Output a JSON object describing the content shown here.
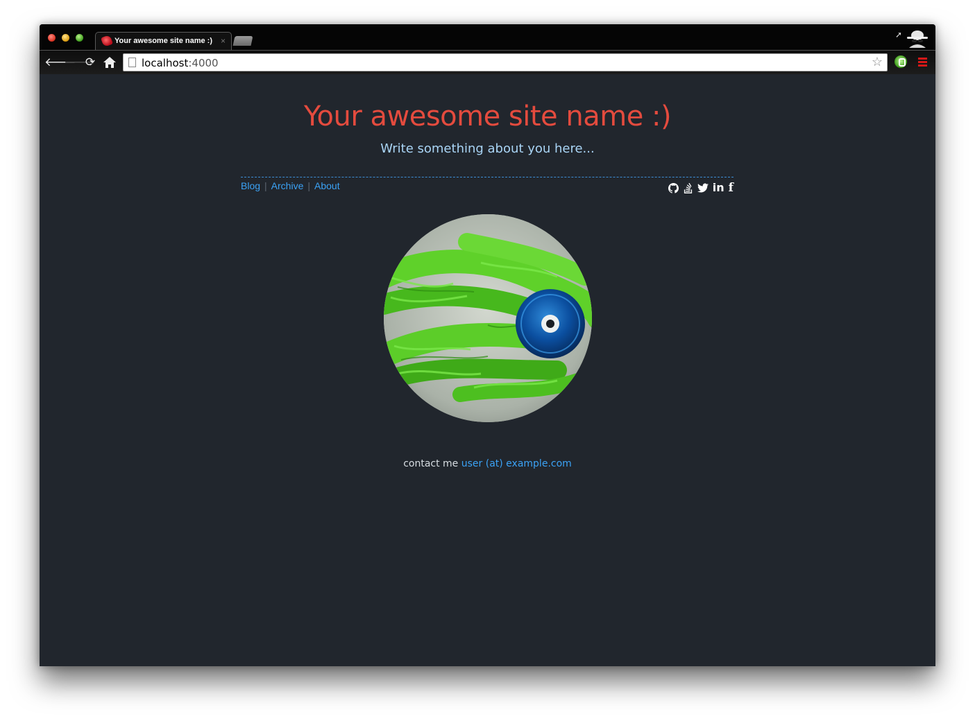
{
  "browser": {
    "tab_title": "Your awesome site name :)",
    "tab_close": "×",
    "url_host": "localhost",
    "url_port": ":4000"
  },
  "site": {
    "title": "Your awesome site name :)",
    "description": "Write something about you here..."
  },
  "nav": {
    "items": [
      {
        "label": "Blog"
      },
      {
        "label": "Archive"
      },
      {
        "label": "About"
      }
    ],
    "separator": "|"
  },
  "social": {
    "icons": [
      "github-icon",
      "stackoverflow-icon",
      "twitter-icon",
      "linkedin-icon",
      "facebook-icon"
    ],
    "linkedin_glyph": "in",
    "facebook_glyph": "f"
  },
  "contact": {
    "prefix": "contact me",
    "email": "user (at) example.com"
  },
  "colors": {
    "page_background": "#21262d",
    "title": "#e44b3e",
    "description": "#a9d4f5",
    "link": "#3ba2f5"
  }
}
